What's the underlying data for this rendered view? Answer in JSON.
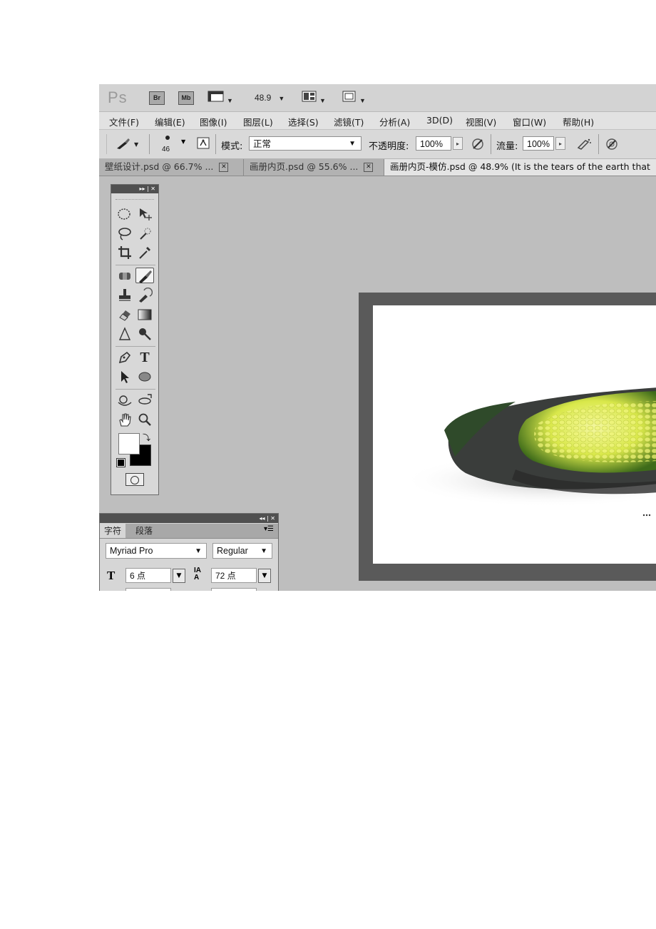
{
  "app": {
    "logo": "Ps",
    "bridge": "Br",
    "mini_bridge": "Mb",
    "zoom": "48.9"
  },
  "menu": [
    "文件(F)",
    "编辑(E)",
    "图像(I)",
    "图层(L)",
    "选择(S)",
    "滤镜(T)",
    "分析(A)",
    "3D(D)",
    "视图(V)",
    "窗口(W)",
    "帮助(H)"
  ],
  "options": {
    "brush_size": "46",
    "mode_label": "模式:",
    "mode_value": "正常",
    "opacity_label": "不透明度:",
    "opacity_value": "100%",
    "flow_label": "流量:",
    "flow_value": "100%"
  },
  "tabs": [
    {
      "title": "壁纸设计.psd @ 66.7% ..."
    },
    {
      "title": "画册内页.psd @ 55.6% ..."
    },
    {
      "title": "画册内页-模仿.psd @ 48.9% (It is the tears of the earth that"
    }
  ],
  "character_panel": {
    "tab_character": "字符",
    "tab_paragraph": "段落",
    "font_family": "Myriad Pro",
    "font_style": "Regular",
    "font_size": "6 点",
    "leading": "72 点"
  },
  "colors": {
    "foreground": "#ffffff",
    "background": "#000000",
    "canvas_frame": "#5a5a5a",
    "workspace": "#bebebe"
  },
  "icons": [
    "brush-icon",
    "marquee-icon",
    "move-icon",
    "lasso-icon",
    "magic-wand-icon",
    "crop-icon",
    "eyedropper-icon",
    "healing-icon",
    "stamp-icon",
    "eraser-icon",
    "gradient-icon",
    "blur-icon",
    "dodge-icon",
    "pen-icon",
    "type-icon",
    "path-select-icon",
    "ellipse-icon",
    "3d-rotate-icon",
    "hand-icon",
    "zoom-icon",
    "quick-mask-icon"
  ]
}
